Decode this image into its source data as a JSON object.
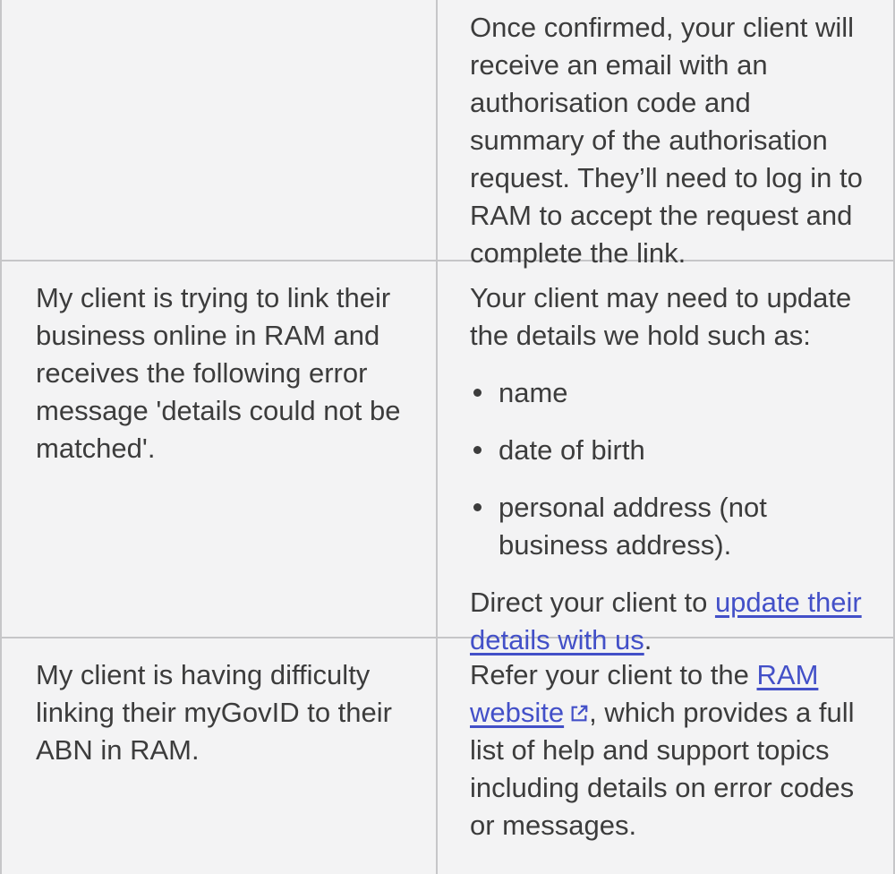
{
  "row0": {
    "answer": "Once confirmed, your client will receive an email with an authorisation code and summary of the authorisation request. They’ll need to log in to RAM to accept the request and complete the link."
  },
  "row1": {
    "question": "My client is trying to link their business online in RAM and receives the following error message 'details could not be matched'.",
    "answer_intro": "Your client may need to update the details we hold such as:",
    "bullets": [
      "name",
      "date of birth",
      "personal address (not business address)."
    ],
    "direct_prefix": "Direct your client to ",
    "direct_link": "update their details with us",
    "direct_suffix": "."
  },
  "row2": {
    "question": "My client is having difficulty linking their myGovID to their ABN in RAM.",
    "refer_prefix": "Refer your client to the ",
    "refer_link": "RAM website",
    "refer_suffix": ", which provides a full list of help and support topics including details on error codes or messages."
  },
  "colors": {
    "link": "#4350c8",
    "border": "#c6c6c8",
    "text": "#3c3c3c",
    "background": "#f3f3f4"
  },
  "icons": {
    "external": "external-link-icon"
  }
}
